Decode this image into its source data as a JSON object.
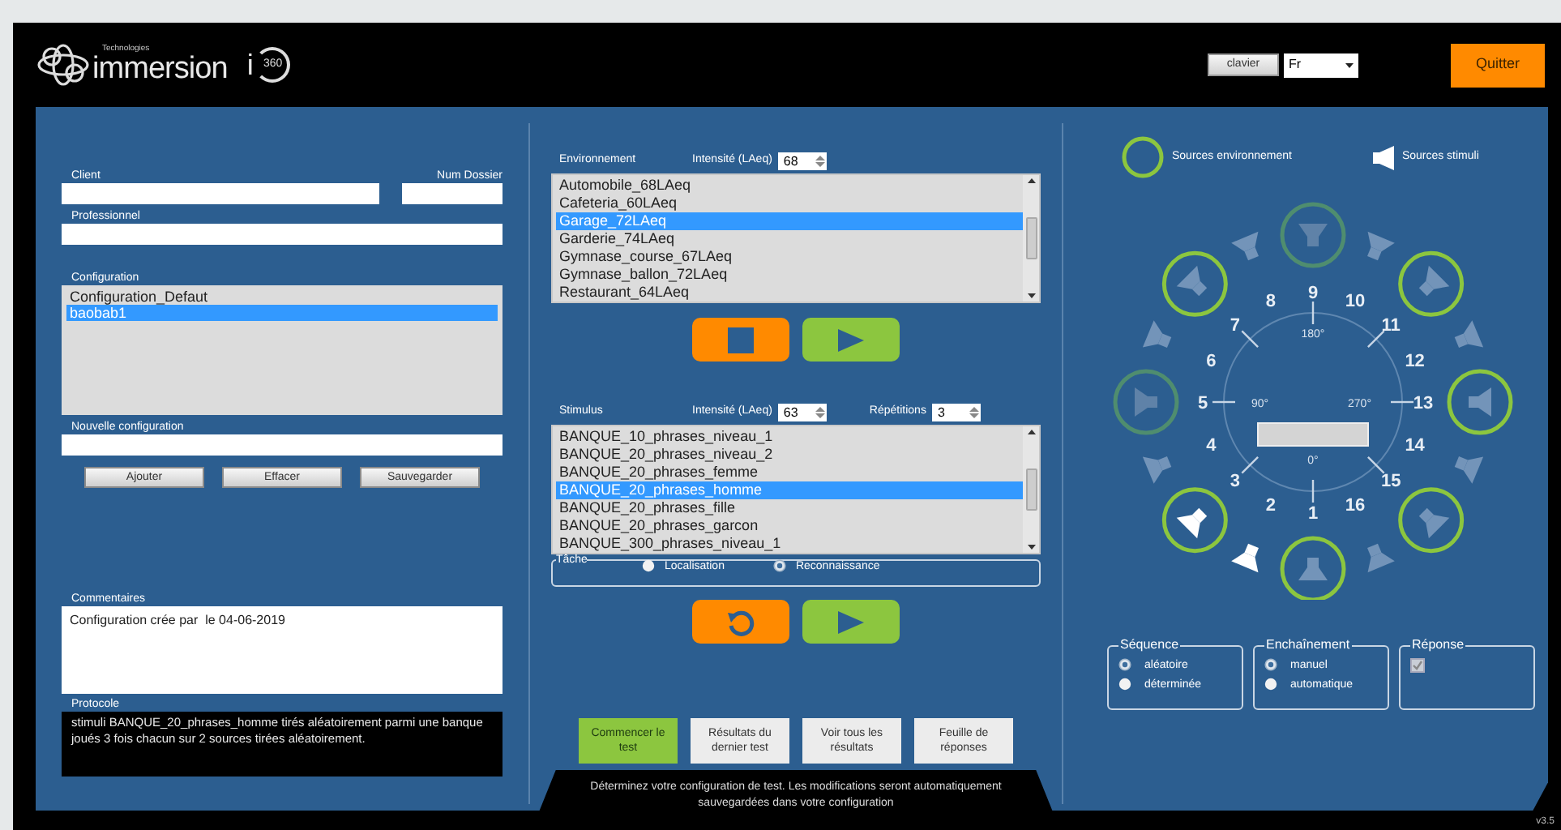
{
  "header": {
    "brand_tag": "Technologies",
    "brand": "immersion",
    "product": "i",
    "product_badge": "360",
    "keyboard_button": "clavier",
    "language": "Fr",
    "quit_button": "Quitter"
  },
  "left": {
    "client_label": "Client",
    "dossier_label": "Num Dossier",
    "professional_label": "Professionnel",
    "configuration_label": "Configuration",
    "configurations": [
      {
        "label": "Configuration_Defaut",
        "selected": false
      },
      {
        "label": "baobab1",
        "selected": true
      }
    ],
    "new_configuration_label": "Nouvelle configuration",
    "buttons": [
      "Ajouter",
      "Effacer",
      "Sauvegarder"
    ],
    "comments_label": "Commentaires",
    "comments": "Configuration crée par  le 04-06-2019",
    "protocol_label": "Protocole",
    "protocol": "stimuli BANQUE_20_phrases_homme tirés aléatoirement parmi une banque joués 3 fois chacun  sur 2 sources tirées aléatoirement."
  },
  "environment": {
    "label": "Environnement",
    "intensity_label": "Intensité (LAeq)",
    "intensity": "68",
    "items": [
      {
        "label": "Automobile_68LAeq",
        "selected": false
      },
      {
        "label": "Cafeteria_60LAeq",
        "selected": false
      },
      {
        "label": "Garage_72LAeq",
        "selected": true
      },
      {
        "label": "Garderie_74LAeq",
        "selected": false
      },
      {
        "label": "Gymnase_course_67LAeq",
        "selected": false
      },
      {
        "label": "Gymnase_ballon_72LAeq",
        "selected": false
      },
      {
        "label": "Restaurant_64LAeq",
        "selected": false
      }
    ]
  },
  "stimulus": {
    "label": "Stimulus",
    "intensity_label": "Intensité (LAeq)",
    "intensity": "63",
    "repetitions_label": "Répétitions",
    "repetitions": "3",
    "items": [
      {
        "label": "BANQUE_10_phrases_niveau_1",
        "selected": false
      },
      {
        "label": "BANQUE_20_phrases_niveau_2",
        "selected": false
      },
      {
        "label": "BANQUE_20_phrases_femme",
        "selected": false
      },
      {
        "label": "BANQUE_20_phrases_homme",
        "selected": true
      },
      {
        "label": "BANQUE_20_phrases_fille",
        "selected": false
      },
      {
        "label": "BANQUE_20_phrases_garcon",
        "selected": false
      },
      {
        "label": "BANQUE_300_phrases_niveau_1",
        "selected": false
      }
    ]
  },
  "task": {
    "title": "Tâche",
    "options": [
      {
        "label": "Localisation",
        "selected": false
      },
      {
        "label": "Reconnaissance",
        "selected": true
      }
    ]
  },
  "actions": [
    {
      "label": "Commencer le test",
      "kind": "primary"
    },
    {
      "label": "Résultats du dernier test",
      "kind": "secondary"
    },
    {
      "label": "Voir tous les résultats",
      "kind": "secondary"
    },
    {
      "label": "Feuille de réponses",
      "kind": "secondary"
    }
  ],
  "footer_hint": "Déterminez votre configuration de test. Les modifications seront automatiquement sauvegardées dans votre configuration",
  "legend": {
    "environment": "Sources environnement",
    "stimulus": "Sources stimuli"
  },
  "angles": [
    "180°",
    "90°",
    "270°",
    "0°"
  ],
  "speakers": [
    {
      "label": "1",
      "environment": true,
      "disabled": false,
      "stimulus": false
    },
    {
      "label": "2",
      "environment": false,
      "disabled": false,
      "stimulus": true
    },
    {
      "label": "3",
      "environment": true,
      "disabled": false,
      "stimulus": true
    },
    {
      "label": "4",
      "environment": false,
      "disabled": false,
      "stimulus": false
    },
    {
      "label": "5",
      "environment": true,
      "disabled": true,
      "stimulus": false
    },
    {
      "label": "6",
      "environment": false,
      "disabled": false,
      "stimulus": false
    },
    {
      "label": "7",
      "environment": true,
      "disabled": false,
      "stimulus": false
    },
    {
      "label": "8",
      "environment": false,
      "disabled": false,
      "stimulus": false
    },
    {
      "label": "9",
      "environment": true,
      "disabled": true,
      "stimulus": false
    },
    {
      "label": "10",
      "environment": false,
      "disabled": false,
      "stimulus": false
    },
    {
      "label": "11",
      "environment": true,
      "disabled": false,
      "stimulus": false
    },
    {
      "label": "12",
      "environment": false,
      "disabled": false,
      "stimulus": false
    },
    {
      "label": "13",
      "environment": true,
      "disabled": false,
      "stimulus": false
    },
    {
      "label": "14",
      "environment": false,
      "disabled": false,
      "stimulus": false
    },
    {
      "label": "15",
      "environment": true,
      "disabled": false,
      "stimulus": false
    },
    {
      "label": "16",
      "environment": false,
      "disabled": false,
      "stimulus": false
    }
  ],
  "sequence": {
    "title": "Séquence",
    "options": [
      {
        "label": "aléatoire",
        "selected": true
      },
      {
        "label": "déterminée",
        "selected": false
      }
    ]
  },
  "chaining": {
    "title": "Enchaînement",
    "options": [
      {
        "label": "manuel",
        "selected": true
      },
      {
        "label": "automatique",
        "selected": false
      }
    ]
  },
  "response": {
    "title": "Réponse",
    "checked": true,
    "disabled": true
  },
  "version": "v3.5"
}
